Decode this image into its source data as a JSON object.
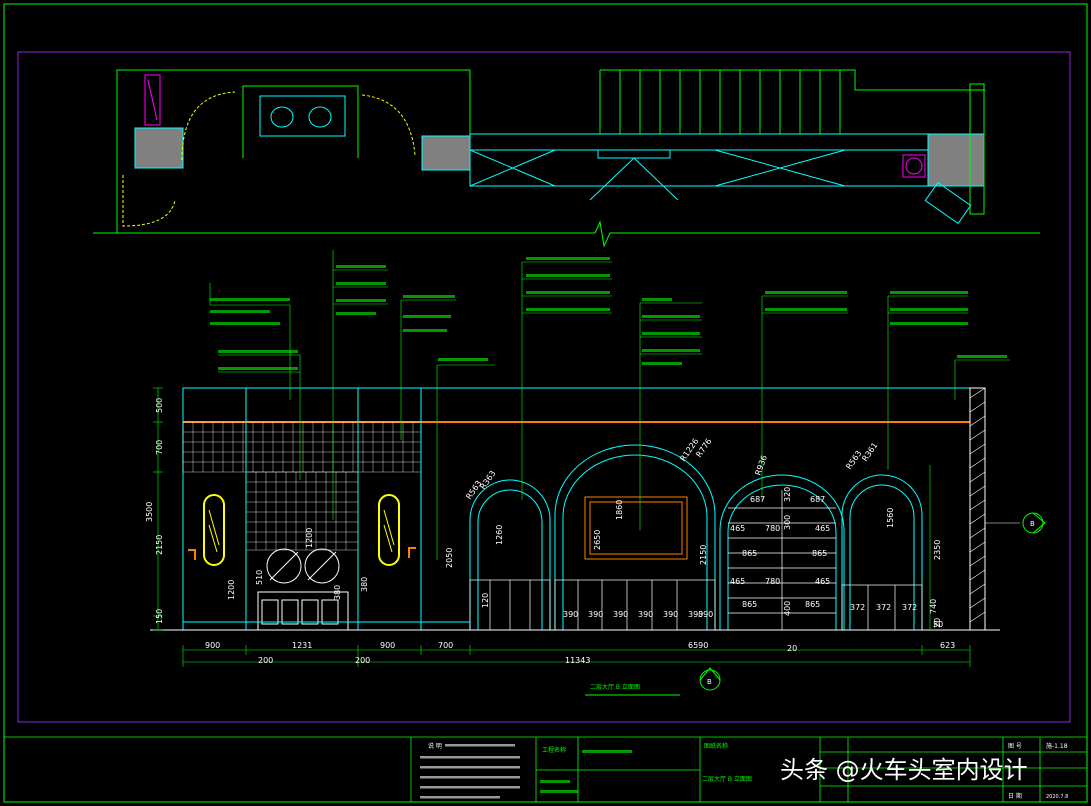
{
  "drawing": {
    "title": "二层大厅 B 立面图",
    "title_block": {
      "label_notes": "说 明",
      "project_name_label": "工程名称",
      "design_label": "图纸名称",
      "drawing_title": "二层大厅 B 立面图",
      "drawing_no_label": "图 号",
      "drawing_no": "施-1.18",
      "date_label": "日 期",
      "date": "2020.7.8"
    },
    "watermark": "头条 @火车头室内设计",
    "axis_markers": [
      "B",
      "B"
    ],
    "dimensions_bottom": [
      "900",
      "1231",
      "900",
      "700",
      "6590",
      "623"
    ],
    "dimensions_bottom_2": [
      "200",
      "200",
      "11343",
      "20"
    ],
    "dimensions_left": [
      "500",
      "700",
      "3500",
      "2150",
      "150"
    ],
    "dimensions_right": [
      "2350",
      "20",
      "50"
    ],
    "arch_radii": [
      "R563",
      "R363",
      "R1226",
      "R776",
      "R936",
      "R563",
      "R361"
    ],
    "cabinet_dims": [
      "390",
      "390",
      "390",
      "390",
      "390",
      "390",
      "390",
      "465",
      "780",
      "465",
      "865",
      "865",
      "465",
      "780",
      "465",
      "865",
      "865",
      "372",
      "372",
      "372",
      "687",
      "687",
      "320",
      "300",
      "1860",
      "2650",
      "2150",
      "1560",
      "2050",
      "1260",
      "740",
      "400",
      "120",
      "380",
      "1200",
      "510",
      "1200",
      "380"
    ]
  },
  "colors": {
    "background": "#000000",
    "frame": "#8a2be2",
    "cyan": "#00ffff",
    "green": "#00ff00",
    "white": "#ffffff",
    "yellow": "#ffff00",
    "magenta": "#ff00ff",
    "orange": "#ff8000",
    "gray": "#808080"
  }
}
